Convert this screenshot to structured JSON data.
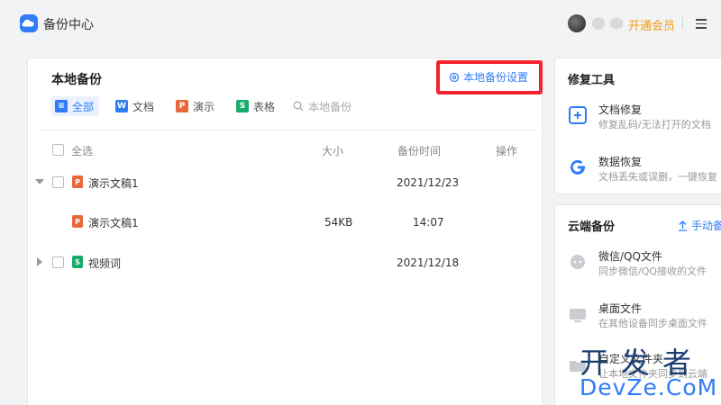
{
  "app": {
    "title": "备份中心"
  },
  "header": {
    "vip_label": "开通会员"
  },
  "local": {
    "title": "本地备份",
    "settings_label": "本地备份设置",
    "filters": [
      {
        "label": "全部",
        "icon": "list-icon",
        "active": true,
        "color": "#2f7cf6"
      },
      {
        "label": "文档",
        "icon": "word-doc-icon",
        "color": "#2f7cf6"
      },
      {
        "label": "演示",
        "icon": "presentation-icon",
        "color": "#e8673b"
      },
      {
        "label": "表格",
        "icon": "spreadsheet-icon",
        "color": "#1aab6c"
      }
    ],
    "search_label": "本地备份",
    "columns": {
      "select_all": "全选",
      "size": "大小",
      "time": "备份时间",
      "action": "操作"
    },
    "rows": [
      {
        "name": "演示文稿1",
        "size": "",
        "time": "2021/12/23",
        "expanded": true
      },
      {
        "name": "演示文稿1",
        "size": "54KB",
        "time": "14:07",
        "child": true
      },
      {
        "name": "视频词",
        "size": "",
        "time": "2021/12/18",
        "expanded": false
      }
    ]
  },
  "repair": {
    "title": "修复工具",
    "items": [
      {
        "title": "文档修复",
        "sub": "修复乱码/无法打开的文档"
      },
      {
        "title": "数据恢复",
        "sub": "文档丢失或误删，一键恢复"
      }
    ]
  },
  "cloud": {
    "title": "云端备份",
    "manual_label": "手动备",
    "items": [
      {
        "title": "微信/QQ文件",
        "sub": "同步微信/QQ接收的文件"
      },
      {
        "title": "桌面文件",
        "sub": "在其他设备同步桌面文件"
      },
      {
        "title": "自定义文件夹",
        "sub": "让本地文件夹同步到云端"
      }
    ]
  },
  "watermark": {
    "cn": "开发者",
    "en": "DevZe.CoM"
  },
  "colors": {
    "accent": "#2f7cf6",
    "vip": "#f39c12",
    "highlight": "#f5222d"
  }
}
